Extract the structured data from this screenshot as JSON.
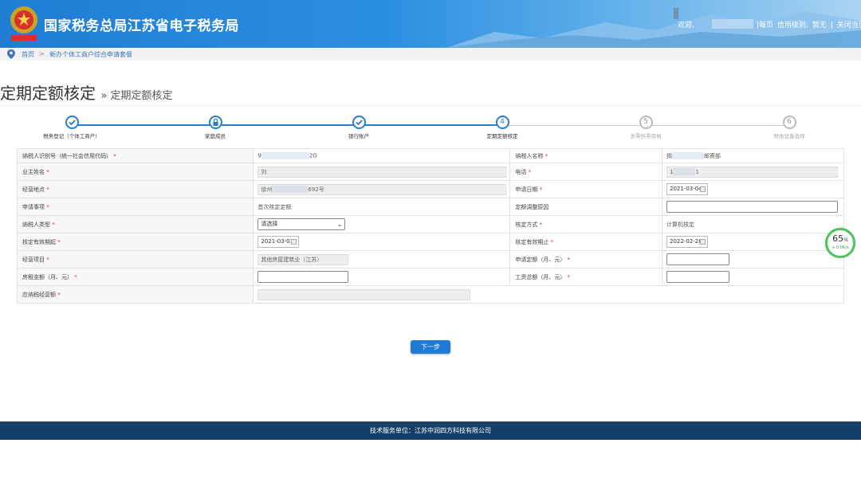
{
  "header": {
    "site_title": "国家税务总局江苏省电子税务局",
    "welcome": "欢迎,",
    "links": [
      "|每页",
      "信用级别:",
      "暂无",
      "|",
      "关闭当页"
    ]
  },
  "breadcrumb": {
    "home": "首页",
    "separator": ">",
    "current": "新办个体工商户综合申请套餐"
  },
  "page": {
    "title": "定期定额核定",
    "subtitle": "» 定期定额核定"
  },
  "steps": [
    {
      "label": "税务登记（个体工商户）",
      "marker": "✓",
      "state": "done"
    },
    {
      "label": "家庭成员",
      "marker": "lock",
      "state": "done"
    },
    {
      "label": "银行账户",
      "marker": "✓",
      "state": "done"
    },
    {
      "label": "定期定额核定",
      "marker": "4",
      "state": "current"
    },
    {
      "label": "发票供票资格",
      "marker": "5",
      "state": "pending"
    },
    {
      "label": "税收设备选择",
      "marker": "6",
      "state": "pending"
    }
  ],
  "form": {
    "taxpayer_id_label": "纳税人识别号（统一社会信用代码）",
    "taxpayer_id_value_prefix": "9",
    "taxpayer_id_value_suffix": "2G",
    "taxpayer_name_label": "纳税人名称",
    "taxpayer_name_prefix": "揭",
    "taxpayer_name_suffix": "邮寄部",
    "owner_label": "业主姓名",
    "owner_value": "刘",
    "phone_label": "电话",
    "phone_value": "1",
    "phone_value_suffix": "1",
    "address_label": "经营地点",
    "address_prefix": "徐州",
    "address_suffix": "692号",
    "apply_date_label": "申请日期",
    "apply_date_value": "2021-03-04",
    "matter_label": "申请事项",
    "matter_value": "首次核定定额",
    "adjust_reason_label": "定额调整原因",
    "type_label": "纳税人类型",
    "type_value": "请选择",
    "method_label": "核定方式",
    "method_value": "计算机核定",
    "start_label": "核定有效期起",
    "start_value": "2021-03-01",
    "end_label": "核定有效期止",
    "end_value": "2022-02-28",
    "project_label": "经营项目",
    "project_value": "其他房屋建筑业（江苏）",
    "monthly_apply_label": "申请定额（月、元）",
    "rent_label": "房租金额（月、元）",
    "wage_label": "工资总额（月、元）",
    "should_label": "应纳税经营额"
  },
  "buttons": {
    "next": "下一步"
  },
  "footer": {
    "text": "技术服务单位：江苏中润四方科技有限公司"
  },
  "gauge": {
    "percent": "65",
    "unit": "%",
    "speed": "+ 0.0K/s"
  }
}
